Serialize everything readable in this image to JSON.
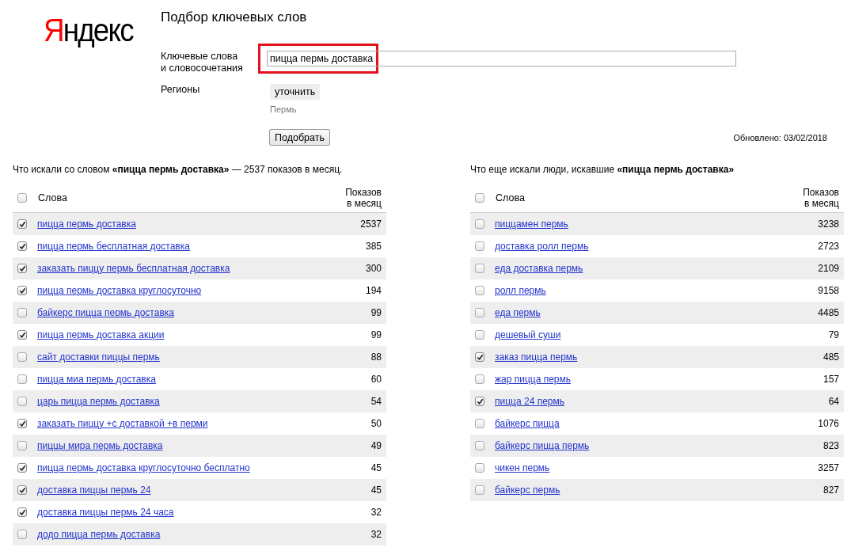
{
  "logo": {
    "initial": "Я",
    "rest": "ндекс"
  },
  "title": "Подбор ключевых слов",
  "keywords_field": {
    "label": "Ключевые слова\nи словосочетания",
    "value": "пицца пермь доставка",
    "highlighted": true
  },
  "regions": {
    "label": "Регионы",
    "button": "уточнить",
    "value": "Пермь"
  },
  "submit_button": "Подобрать",
  "updated": "Обновлено: 03/02/2018",
  "tables": [
    {
      "caption": "Что искали со словом **«пицца пермь доставка»** — 2537 показов в месяц.",
      "columns": [
        "Слова",
        "Показов\nв месяц"
      ],
      "all_checked": false,
      "rows": [
        {
          "phrase": "пицца пермь доставка",
          "count": "2537",
          "checked": true
        },
        {
          "phrase": "пицца пермь бесплатная доставка",
          "count": "385",
          "checked": true
        },
        {
          "phrase": "заказать пиццу пермь бесплатная доставка",
          "count": "300",
          "checked": true
        },
        {
          "phrase": "пицца пермь доставка круглосуточно",
          "count": "194",
          "checked": true
        },
        {
          "phrase": "байкерс пицца пермь доставка",
          "count": "99",
          "checked": false
        },
        {
          "phrase": "пицца пермь доставка акции",
          "count": "99",
          "checked": true
        },
        {
          "phrase": "сайт доставки пиццы пермь",
          "count": "88",
          "checked": false
        },
        {
          "phrase": "пицца миа пермь доставка",
          "count": "60",
          "checked": false
        },
        {
          "phrase": "царь пицца пермь доставка",
          "count": "54",
          "checked": false
        },
        {
          "phrase": "заказать пиццу +с доставкой +в перми",
          "count": "50",
          "checked": true
        },
        {
          "phrase": "пиццы мира пермь доставка",
          "count": "49",
          "checked": false
        },
        {
          "phrase": "пицца пермь доставка круглосуточно бесплатно",
          "count": "45",
          "checked": true
        },
        {
          "phrase": "доставка пиццы пермь 24",
          "count": "45",
          "checked": true
        },
        {
          "phrase": "доставка пиццы пермь 24 часа",
          "count": "32",
          "checked": true
        },
        {
          "phrase": "додо пицца пермь доставка",
          "count": "32",
          "checked": false
        }
      ]
    },
    {
      "caption": "Что еще искали люди, искавшие **«пицца пермь доставка»**",
      "columns": [
        "Слова",
        "Показов\nв месяц"
      ],
      "all_checked": false,
      "rows": [
        {
          "phrase": "пиццамен пермь",
          "count": "3238",
          "checked": false
        },
        {
          "phrase": "доставка ролл пермь",
          "count": "2723",
          "checked": false
        },
        {
          "phrase": "еда доставка пермь",
          "count": "2109",
          "checked": false
        },
        {
          "phrase": "ролл пермь",
          "count": "9158",
          "checked": false
        },
        {
          "phrase": "еда пермь",
          "count": "4485",
          "checked": false
        },
        {
          "phrase": "дешевый суши",
          "count": "79",
          "checked": false
        },
        {
          "phrase": "заказ пицца пермь",
          "count": "485",
          "checked": true
        },
        {
          "phrase": "жар пицца пермь",
          "count": "157",
          "checked": false
        },
        {
          "phrase": "пицца 24 пермь",
          "count": "64",
          "checked": true
        },
        {
          "phrase": "байкерс пицца",
          "count": "1076",
          "checked": false
        },
        {
          "phrase": "байкерс пицца пермь",
          "count": "823",
          "checked": false
        },
        {
          "phrase": "чикен пермь",
          "count": "3257",
          "checked": false
        },
        {
          "phrase": "байкерс пермь",
          "count": "827",
          "checked": false
        }
      ]
    }
  ]
}
